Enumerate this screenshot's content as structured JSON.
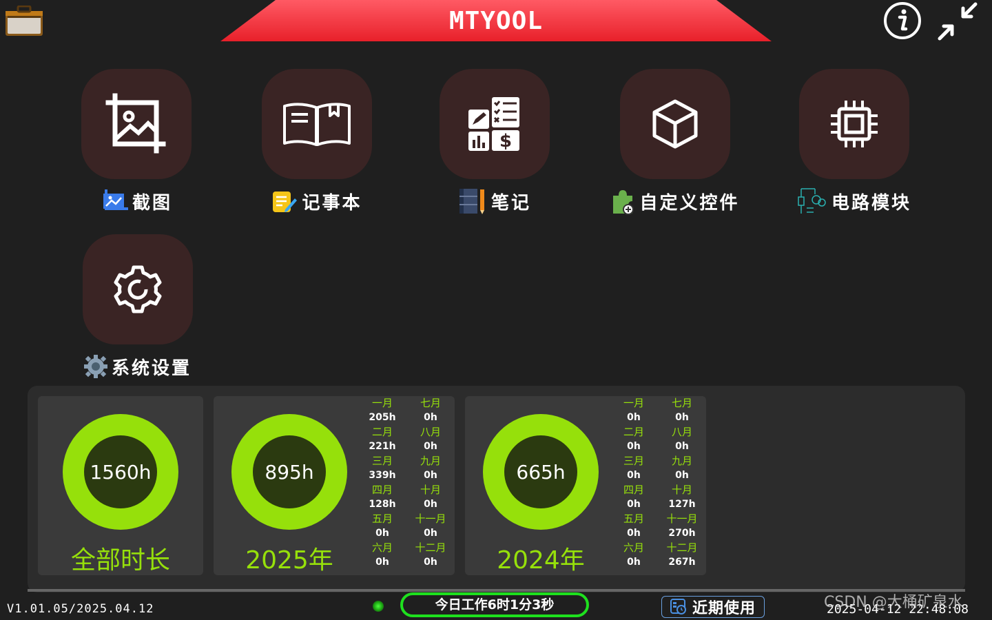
{
  "title": "MTYOOL",
  "apps": [
    {
      "label": "截图",
      "icon": "crop-image-icon"
    },
    {
      "label": "记事本",
      "icon": "book-icon"
    },
    {
      "label": "笔记",
      "icon": "finance-notes-icon"
    },
    {
      "label": "自定义控件",
      "icon": "cube-icon"
    },
    {
      "label": "电路模块",
      "icon": "chip-icon"
    },
    {
      "label": "系统设置",
      "icon": "gear-icon"
    }
  ],
  "stats": {
    "total": {
      "value": "1560h",
      "label": "全部时长"
    },
    "year_2025": {
      "value": "895h",
      "label": "2025年",
      "months": [
        {
          "name": "一月",
          "hours": "205h"
        },
        {
          "name": "二月",
          "hours": "221h"
        },
        {
          "name": "三月",
          "hours": "339h"
        },
        {
          "name": "四月",
          "hours": "128h"
        },
        {
          "name": "五月",
          "hours": "0h"
        },
        {
          "name": "六月",
          "hours": "0h"
        },
        {
          "name": "七月",
          "hours": "0h"
        },
        {
          "name": "八月",
          "hours": "0h"
        },
        {
          "name": "九月",
          "hours": "0h"
        },
        {
          "name": "十月",
          "hours": "0h"
        },
        {
          "name": "十一月",
          "hours": "0h"
        },
        {
          "name": "十二月",
          "hours": "0h"
        }
      ]
    },
    "year_2024": {
      "value": "665h",
      "label": "2024年",
      "months": [
        {
          "name": "一月",
          "hours": "0h"
        },
        {
          "name": "二月",
          "hours": "0h"
        },
        {
          "name": "三月",
          "hours": "0h"
        },
        {
          "name": "四月",
          "hours": "0h"
        },
        {
          "name": "五月",
          "hours": "0h"
        },
        {
          "name": "六月",
          "hours": "0h"
        },
        {
          "name": "七月",
          "hours": "0h"
        },
        {
          "name": "八月",
          "hours": "0h"
        },
        {
          "name": "九月",
          "hours": "0h"
        },
        {
          "name": "十月",
          "hours": "127h"
        },
        {
          "name": "十一月",
          "hours": "270h"
        },
        {
          "name": "十二月",
          "hours": "267h"
        }
      ]
    }
  },
  "footer": {
    "version": "V1.01.05/2025.04.12",
    "work_time": "今日工作6时1分3秒",
    "recent": "近期使用",
    "datetime": "2025-04-12 22:48:08",
    "watermark": "CSDN @大桶矿泉水"
  },
  "colors": {
    "accent": "#96e00b",
    "title_bar": "#f0303a",
    "tile": "#3a2424",
    "worktime_border": "#1ee01e"
  }
}
